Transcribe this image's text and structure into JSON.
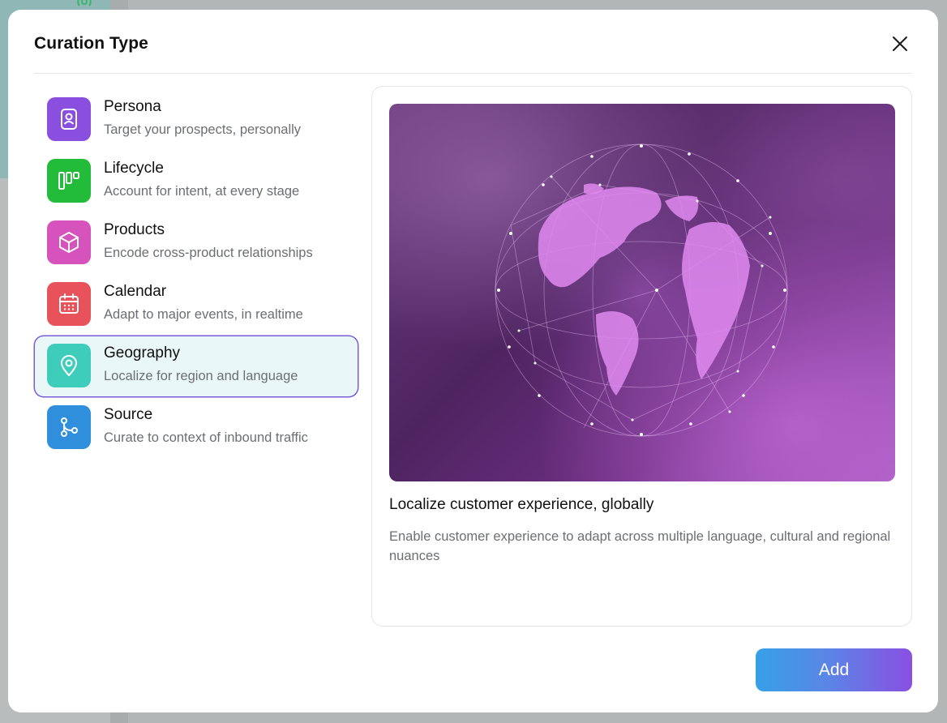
{
  "modal": {
    "title": "Curation Type",
    "close_icon": "close-icon"
  },
  "types": [
    {
      "name": "Persona",
      "desc": "Target your prospects, personally",
      "icon": "persona-icon",
      "color": "#8b4fe0"
    },
    {
      "name": "Lifecycle",
      "desc": "Account for intent, at every stage",
      "icon": "lifecycle-icon",
      "color": "#22bb3a"
    },
    {
      "name": "Products",
      "desc": "Encode cross-product relationships",
      "icon": "cube-icon",
      "color": "#d653bd"
    },
    {
      "name": "Calendar",
      "desc": "Adapt to major events, in realtime",
      "icon": "calendar-icon",
      "color": "#e8525a"
    },
    {
      "name": "Geography",
      "desc": "Localize for region and language",
      "icon": "location-pin-icon",
      "color": "#3fcdbb"
    },
    {
      "name": "Source",
      "desc": "Curate to context of inbound traffic",
      "icon": "branch-icon",
      "color": "#2f8fdc"
    }
  ],
  "selected_type": "Geography",
  "preview": {
    "image": "globe-network-illustration",
    "title": "Localize customer experience, globally",
    "description": "Enable customer experience to adapt across multiple language, cultural and regional nuances"
  },
  "actions": {
    "add_label": "Add"
  },
  "colors": {
    "accent_gradient_start": "#36a0e8",
    "accent_gradient_end": "#8a4fe2",
    "selected_border": "#7b5cd6",
    "selected_bg": "#e9f8f7"
  }
}
